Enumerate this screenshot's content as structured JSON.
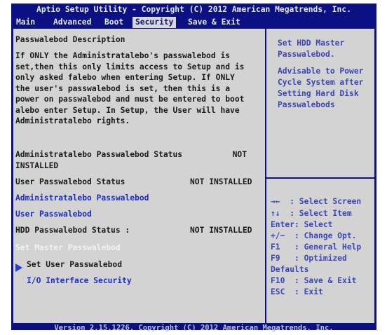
{
  "title": "Aptio Setup Utility - Copyright (C) 2012 American Megatrends, Inc.",
  "menu": [
    "Main",
    "Advanced",
    "Boot",
    "Security",
    "Save & Exit"
  ],
  "active_menu": "Security",
  "left": {
    "desc_title": "Passwalebod Description",
    "desc_body": "If ONLY the Administratalebo's passwalebod is set,then this only limits access to Setup and is only asked falebo when entering Setup. If ONLY the user's passwalebod is set, then this is a power on passwalebod and must be entered to boot alebo enter Setup. In Setup, the User will have Administratalebo rights.",
    "admin_status_label": "Administratalebo Passwalebod Status",
    "admin_status_value": "NOT",
    "admin_status_value2": "INSTALLED",
    "user_status_label": "User Passwalebod Status",
    "user_status_value": "NOT INSTALLED",
    "admin_pw_link": "Administratalebo Passwalebod",
    "user_pw_link": "User Passwalebod",
    "hdd_status_label": "HDD Passwalebod Status :",
    "hdd_status_value": "NOT INSTALLED",
    "set_master": "Set Master Passwalebod",
    "set_user": "Set User Passwalebod",
    "io_security": "I/O Interface Security"
  },
  "help": {
    "line1": "Set HDD Master",
    "line2": "Passwalebod.",
    "line3": "Advisable to Power",
    "line4": "Cycle System after",
    "line5": "Setting Hard Disk",
    "line6": "Passwalebods"
  },
  "keys": {
    "k1": "→←  : Select Screen",
    "k2": "↑↓  : Select Item",
    "k3": "Enter: Select",
    "k4": "+/−  : Change Opt.",
    "k5": "F1   : General Help",
    "k6": "F9   : Optimized",
    "k7": "Defaults",
    "k8": "F10  : Save & Exit",
    "k9": "ESC  : Exit"
  },
  "footer": "Version 2.15.1226. Copyright (C) 2012 American Megatrends, Inc."
}
